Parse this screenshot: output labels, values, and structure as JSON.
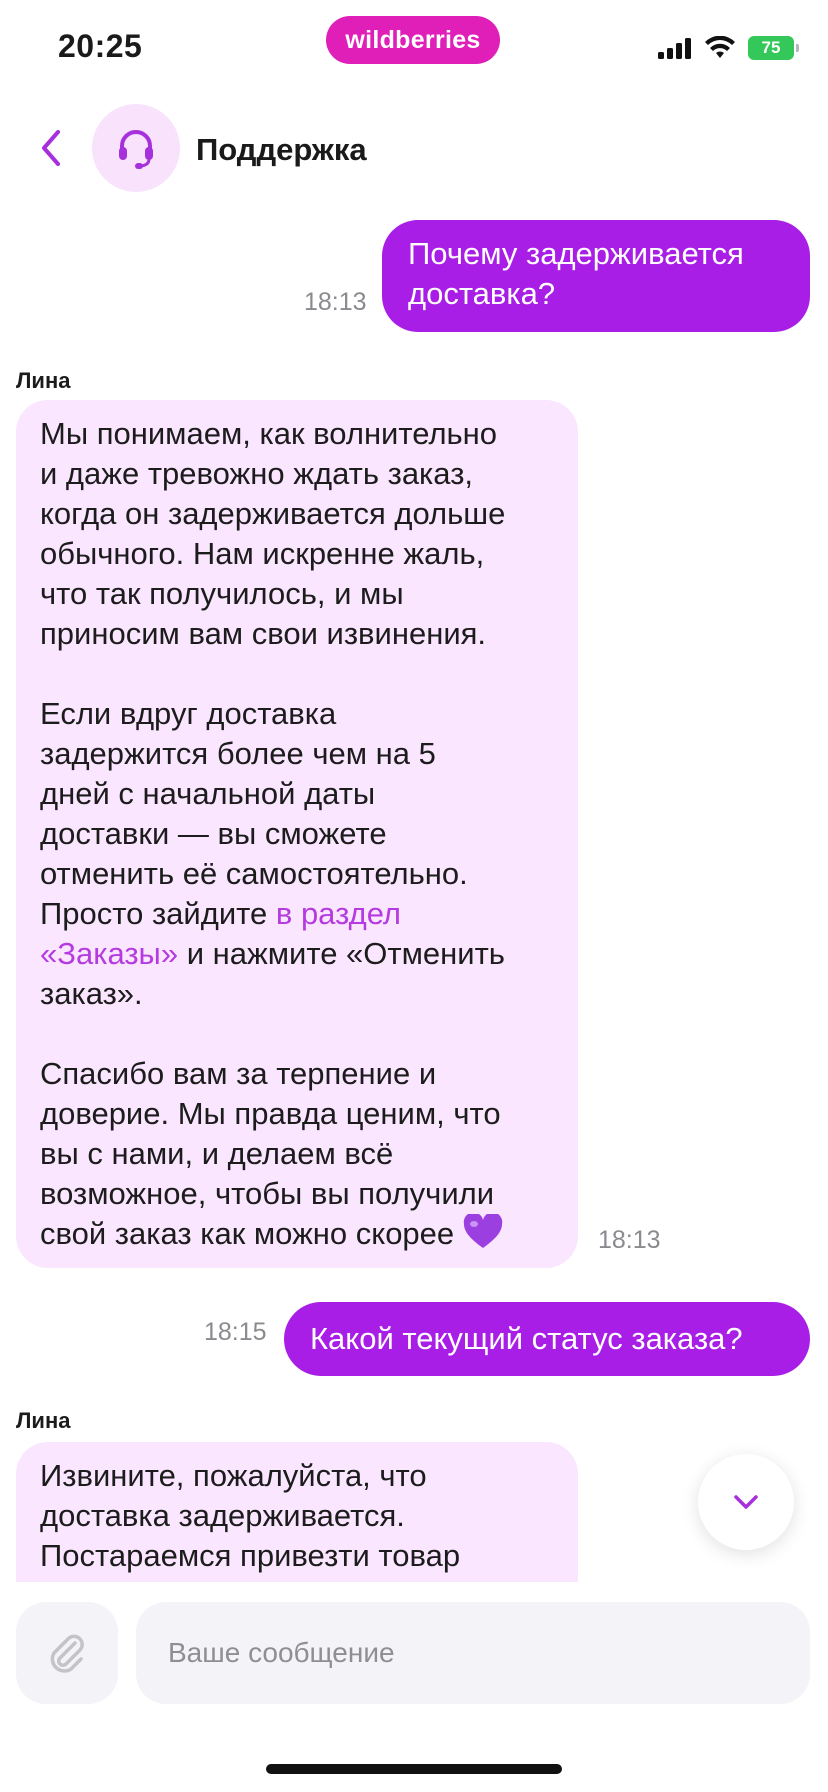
{
  "status_bar": {
    "time": "20:25",
    "battery": "75",
    "brand": "wildberries"
  },
  "header": {
    "back_icon": "chevron-left-icon",
    "avatar_icon": "headset-icon",
    "title": "Поддержка"
  },
  "messages": [
    {
      "direction": "out",
      "time": "18:13",
      "lines": [
        "Почему задерживается",
        "доставка?"
      ]
    },
    {
      "direction": "in",
      "sender": "Лина",
      "time": "18:13",
      "p1": [
        "Мы понимаем, как волнительно",
        "и даже тревожно ждать заказ,",
        "когда он задерживается дольше",
        "обычного. Нам искренне жаль,",
        "что так получилось, и мы",
        "приносим вам свои извинения."
      ],
      "p2": [
        "Если вдруг доставка",
        "задержится более чем на 5",
        "дней с начальной даты",
        "доставки — вы сможете",
        "отменить её самостоятельно."
      ],
      "p2_tail": {
        "before_link": "Просто зайдите ",
        "link_line1": "в раздел",
        "link_line2": "«Заказы»",
        "after_link": " и нажмите «Отменить",
        "last": "заказ»."
      },
      "p3": [
        "Спасибо вам за терпение и",
        "доверие. Мы правда ценим, что",
        "вы с нами, и делаем всё",
        "возможное, чтобы вы получили",
        "свой заказ как можно скорее"
      ],
      "emoji": "purple-heart-icon"
    },
    {
      "direction": "out",
      "time": "18:15",
      "text": "Какой текущий статус заказа?"
    },
    {
      "direction": "in",
      "sender": "Лина",
      "lines": [
        "Извините, пожалуйста, что",
        "доставка задерживается.",
        "Постараемся привезти товар"
      ]
    }
  ],
  "composer": {
    "placeholder": "Ваше сообщение",
    "attach_icon": "paperclip-icon"
  },
  "colors": {
    "accent": "#a91ee6",
    "incoming_bg": "#fae6ff",
    "link": "#b53ae0",
    "brand": "#e01fb8"
  }
}
